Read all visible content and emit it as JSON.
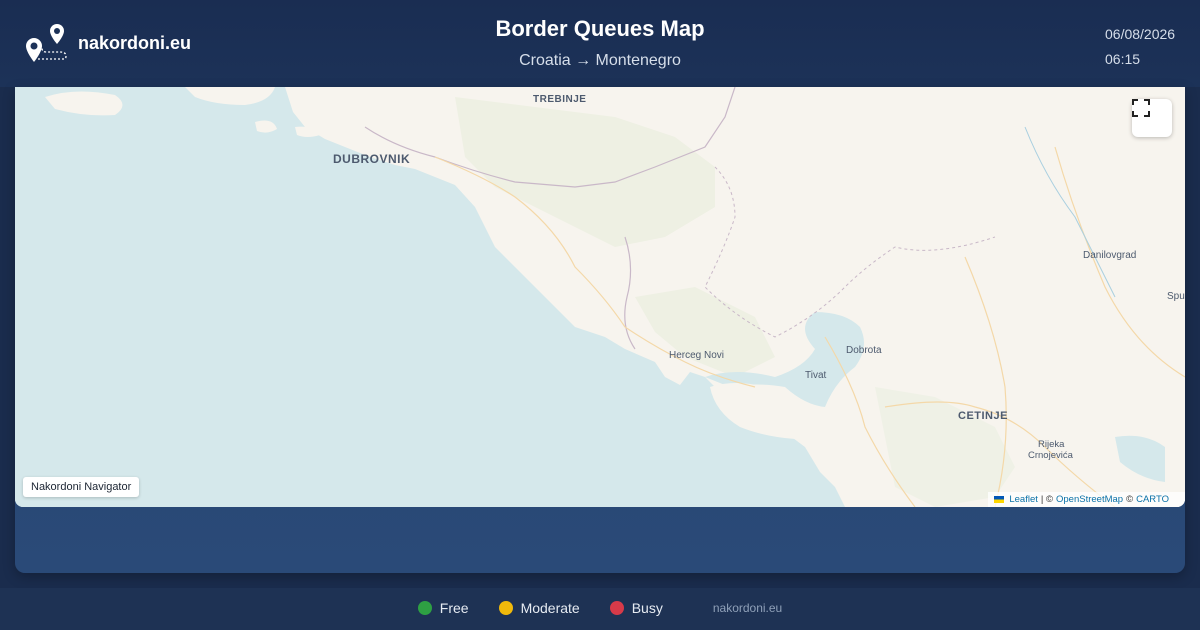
{
  "brand": {
    "name": "nakordoni.eu",
    "logo_icon": "map-pins-route-icon"
  },
  "header": {
    "title": "Border Queues Map",
    "route": "Croatia → Montenegro"
  },
  "datetime": {
    "date": "06/08/2026",
    "time": "06:15"
  },
  "map": {
    "badge": "Nakordoni Navigator",
    "fullscreen_icon": "fullscreen-icon",
    "attribution": {
      "leaflet": "Leaflet",
      "sep1": "| ©",
      "osm": "OpenStreetMap",
      "sep2": "©",
      "carto": "CARTO"
    },
    "places": {
      "trebinje": "TREBINJE",
      "dubrovnik": "DUBROVNIK",
      "danilovgrad": "Danilovgrad",
      "spuz": "Spu",
      "herceg_novi": "Herceg Novi",
      "dobrota": "Dobrota",
      "tivat": "Tivat",
      "cetinje": "CETINJE",
      "rijeka_1": "Rijeka",
      "rijeka_2": "Crnojevića"
    }
  },
  "legend": {
    "free": {
      "label": "Free",
      "color": "#2ea043"
    },
    "moderate": {
      "label": "Moderate",
      "color": "#f0b90b"
    },
    "busy": {
      "label": "Busy",
      "color": "#d73a49"
    }
  },
  "footer": {
    "site": "nakordoni.eu"
  }
}
